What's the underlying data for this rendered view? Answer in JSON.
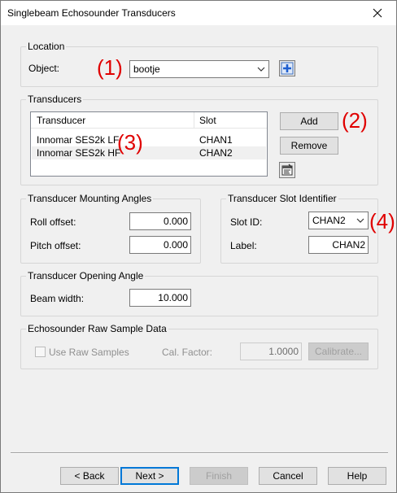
{
  "window": {
    "title": "Singlebeam Echosounder Transducers"
  },
  "location": {
    "title": "Location",
    "object_label": "Object:",
    "object_value": "bootje"
  },
  "transducers": {
    "title": "Transducers",
    "columns": [
      "Transducer",
      "Slot"
    ],
    "rows": [
      {
        "transducer": "Innomar SES2k LF",
        "slot": "CHAN1"
      },
      {
        "transducer": "Innomar SES2k HF",
        "slot": "CHAN2"
      }
    ],
    "add_label": "Add",
    "remove_label": "Remove"
  },
  "mounting": {
    "title": "Transducer Mounting Angles",
    "roll_label": "Roll offset:",
    "roll_value": "0.000",
    "pitch_label": "Pitch offset:",
    "pitch_value": "0.000"
  },
  "slot_identifier": {
    "title": "Transducer Slot Identifier",
    "slot_label": "Slot ID:",
    "slot_value": "CHAN2",
    "label_label": "Label:",
    "label_value": "CHAN2"
  },
  "opening": {
    "title": "Transducer Opening Angle",
    "beam_label": "Beam width:",
    "beam_value": "10.000"
  },
  "raw": {
    "title": "Echosounder Raw Sample Data",
    "use_raw_label": "Use Raw Samples",
    "cal_label": "Cal. Factor:",
    "cal_value": "1.0000",
    "calibrate_label": "Calibrate..."
  },
  "footer": {
    "back_label": "< Back",
    "next_label": "Next >",
    "finish_label": "Finish",
    "cancel_label": "Cancel",
    "help_label": "Help"
  },
  "annotations": [
    "(1)",
    "(2)",
    "(3)",
    "(4)"
  ],
  "colors": {
    "annotation": "#e00000",
    "accent": "#0078d7",
    "selection": "#f0f0f0"
  }
}
